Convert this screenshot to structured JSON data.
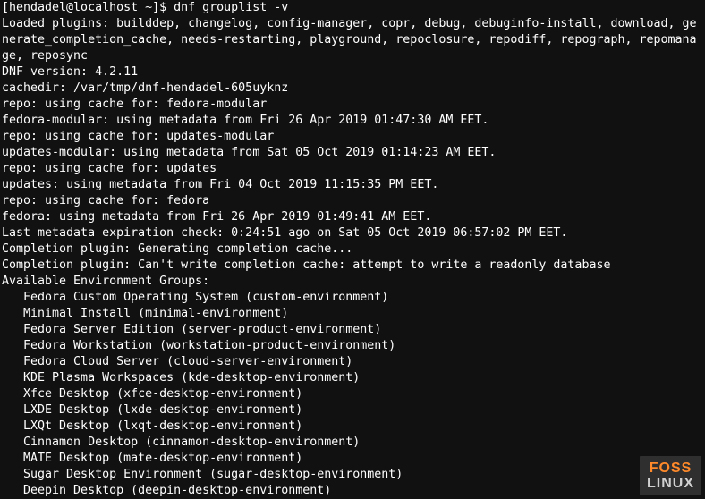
{
  "prompt": {
    "user": "[hendadel@localhost ~]$ ",
    "command": "dnf grouplist -v"
  },
  "output": {
    "lines": [
      "Loaded plugins: builddep, changelog, config-manager, copr, debug, debuginfo-install, download, generate_completion_cache, needs-restarting, playground, repoclosure, repodiff, repograph, repomanage, reposync",
      "DNF version: 4.2.11",
      "cachedir: /var/tmp/dnf-hendadel-605uyknz",
      "repo: using cache for: fedora-modular",
      "fedora-modular: using metadata from Fri 26 Apr 2019 01:47:30 AM EET.",
      "repo: using cache for: updates-modular",
      "updates-modular: using metadata from Sat 05 Oct 2019 01:14:23 AM EET.",
      "repo: using cache for: updates",
      "updates: using metadata from Fri 04 Oct 2019 11:15:35 PM EET.",
      "repo: using cache for: fedora",
      "fedora: using metadata from Fri 26 Apr 2019 01:49:41 AM EET.",
      "Last metadata expiration check: 0:24:51 ago on Sat 05 Oct 2019 06:57:02 PM EET.",
      "Completion plugin: Generating completion cache...",
      "Completion plugin: Can't write completion cache: attempt to write a readonly database",
      "Available Environment Groups:"
    ],
    "env_groups": [
      "Fedora Custom Operating System (custom-environment)",
      "Minimal Install (minimal-environment)",
      "Fedora Server Edition (server-product-environment)",
      "Fedora Workstation (workstation-product-environment)",
      "Fedora Cloud Server (cloud-server-environment)",
      "KDE Plasma Workspaces (kde-desktop-environment)",
      "Xfce Desktop (xfce-desktop-environment)",
      "LXDE Desktop (lxde-desktop-environment)",
      "LXQt Desktop (lxqt-desktop-environment)",
      "Cinnamon Desktop (cinnamon-desktop-environment)",
      "MATE Desktop (mate-desktop-environment)",
      "Sugar Desktop Environment (sugar-desktop-environment)",
      "Deepin Desktop (deepin-desktop-environment)"
    ]
  },
  "watermark": {
    "line1": "FOSS",
    "line2": "LINUX"
  }
}
